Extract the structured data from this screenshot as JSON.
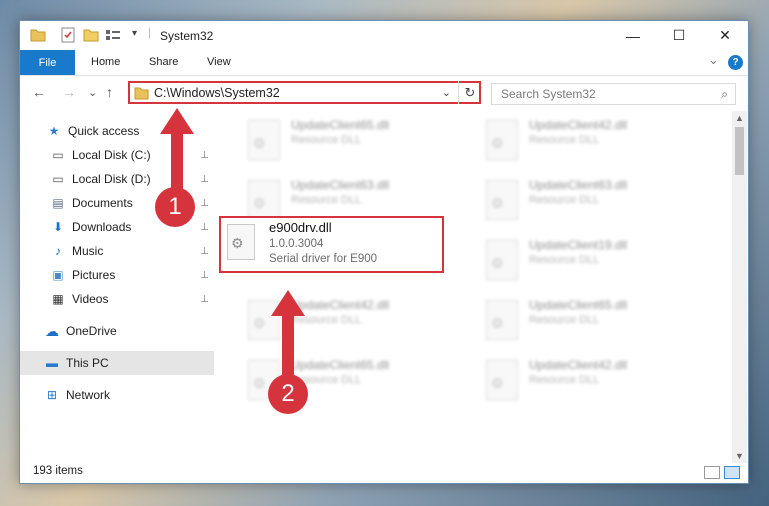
{
  "window": {
    "title": "System32",
    "controls": {
      "minimize": "—",
      "maximize": "☐",
      "close": "✕"
    }
  },
  "ribbon": {
    "tabs": [
      "File",
      "Home",
      "Share",
      "View"
    ],
    "expand": "⌄",
    "help": "?"
  },
  "nav": {
    "back": "←",
    "forward": "→",
    "recent": "⌄",
    "up": "↑",
    "address": "C:\\Windows\\System32",
    "address_chevron": "⌄",
    "refresh": "↻",
    "search_placeholder": "Search System32",
    "search_icon": "⌕"
  },
  "sidebar": {
    "items": [
      {
        "label": "Quick access",
        "icon": "star-icon",
        "glyph": "★",
        "pinned": false,
        "color": "#2d7dd2"
      },
      {
        "label": "Local Disk (C:)",
        "icon": "drive-icon",
        "glyph": "▭",
        "pinned": true,
        "color": "#555"
      },
      {
        "label": "Local Disk (D:)",
        "icon": "drive-icon",
        "glyph": "▭",
        "pinned": true,
        "color": "#555"
      },
      {
        "label": "Documents",
        "icon": "documents-icon",
        "glyph": "▤",
        "pinned": true,
        "color": "#5b6d82"
      },
      {
        "label": "Downloads",
        "icon": "downloads-icon",
        "glyph": "⬇",
        "pinned": true,
        "color": "#1f73c7"
      },
      {
        "label": "Music",
        "icon": "music-icon",
        "glyph": "♪",
        "pinned": true,
        "color": "#2a6fc0"
      },
      {
        "label": "Pictures",
        "icon": "pictures-icon",
        "glyph": "▣",
        "pinned": true,
        "color": "#4a8cc2"
      },
      {
        "label": "Videos",
        "icon": "videos-icon",
        "glyph": "▦",
        "pinned": true,
        "color": "#333"
      },
      {
        "label": "OneDrive",
        "icon": "cloud-icon",
        "glyph": "☁",
        "pinned": false,
        "color": "#1e6fc8"
      },
      {
        "label": "This PC",
        "icon": "computer-icon",
        "glyph": "▬",
        "pinned": false,
        "color": "#2a7bd0",
        "selected": true
      },
      {
        "label": "Network",
        "icon": "network-icon",
        "glyph": "⊞",
        "pinned": false,
        "color": "#2a7bd0"
      }
    ],
    "pin_glyph": "📌"
  },
  "files": {
    "background_tiles": [
      {
        "name": "UpdateClient65.dll",
        "sub": "Resource DLL"
      },
      {
        "name": "UpdateClient42.dll",
        "sub": "Resource DLL"
      },
      {
        "name": "UpdateClient63.dll",
        "sub": "Resource DLL"
      },
      {
        "name": "UpdateClient63.dll",
        "sub": "Resource DLL"
      },
      {
        "name": "",
        "sub": ""
      },
      {
        "name": "UpdateClient19.dll",
        "sub": "Resource DLL"
      },
      {
        "name": "UpdateClient42.dll",
        "sub": "Resource DLL"
      },
      {
        "name": "UpdateClient65.dll",
        "sub": "Resource DLL"
      },
      {
        "name": "UpdateClient65.dll",
        "sub": "Resource DLL"
      },
      {
        "name": "UpdateClient42.dll",
        "sub": "Resource DLL"
      }
    ],
    "highlighted": {
      "name": "e900drv.dll",
      "version": "1.0.0.3004",
      "description": "Serial driver for E900"
    }
  },
  "status": {
    "items_count": "193 items"
  },
  "annotations": {
    "badge1": "1",
    "badge2": "2",
    "color": "#d6343d"
  }
}
